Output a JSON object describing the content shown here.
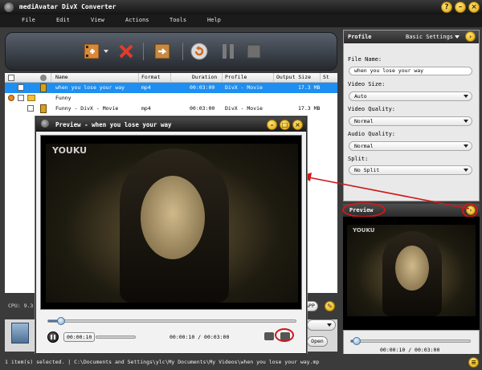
{
  "app": {
    "title": "mediAvatar DivX Converter"
  },
  "menu": [
    "File",
    "Edit",
    "View",
    "Actions",
    "Tools",
    "Help"
  ],
  "table": {
    "headers": [
      "Name",
      "Format",
      "Duration",
      "Profile",
      "Output Size",
      "St"
    ],
    "rows": [
      {
        "name": "when you lose your way",
        "format": "mp4",
        "duration": "00:03:00",
        "profile": "DivX - Movie",
        "size": "17.3 MB"
      },
      {
        "name": "Funny"
      },
      {
        "name": "Funny - DivX - Movie",
        "format": "mp4",
        "duration": "00:03:00",
        "profile": "DivX - Movie",
        "size": "17.3 MB"
      }
    ]
  },
  "side": {
    "cpu_label": "CPU: 9.3",
    "app_label": "APP",
    "open_label": "Open"
  },
  "profile_panel": {
    "title": "Profile",
    "settings_label": "Basic Settings",
    "file_name_label": "File Name:",
    "file_name_value": "when you lose your way",
    "video_size_label": "Video Size:",
    "video_size_value": "Auto",
    "video_quality_label": "Video Quality:",
    "video_quality_value": "Normal",
    "audio_quality_label": "Audio Quality:",
    "audio_quality_value": "Normal",
    "split_label": "Split:",
    "split_value": "No Split"
  },
  "preview_panel": {
    "title": "Preview",
    "watermark": "YOUKU",
    "time": "00:00:10 / 00:03:00",
    "seek_progress": 0.055
  },
  "preview_window": {
    "title": "Preview - when you lose your way",
    "watermark": "YOUKU",
    "current_time_box": "00:00:10",
    "time": "00:00:10 / 00:03:00",
    "seek_progress": 0.055
  },
  "status": {
    "text": "1 item(s) selected. | C:\\Documents and Settings\\ylc\\My Documents\\My Videos\\when you lose your way.mp"
  },
  "colors": {
    "selected_row": "#1e8ff0",
    "annotation_red": "#cc1a1a",
    "accent_yellow": "#f5c000"
  }
}
